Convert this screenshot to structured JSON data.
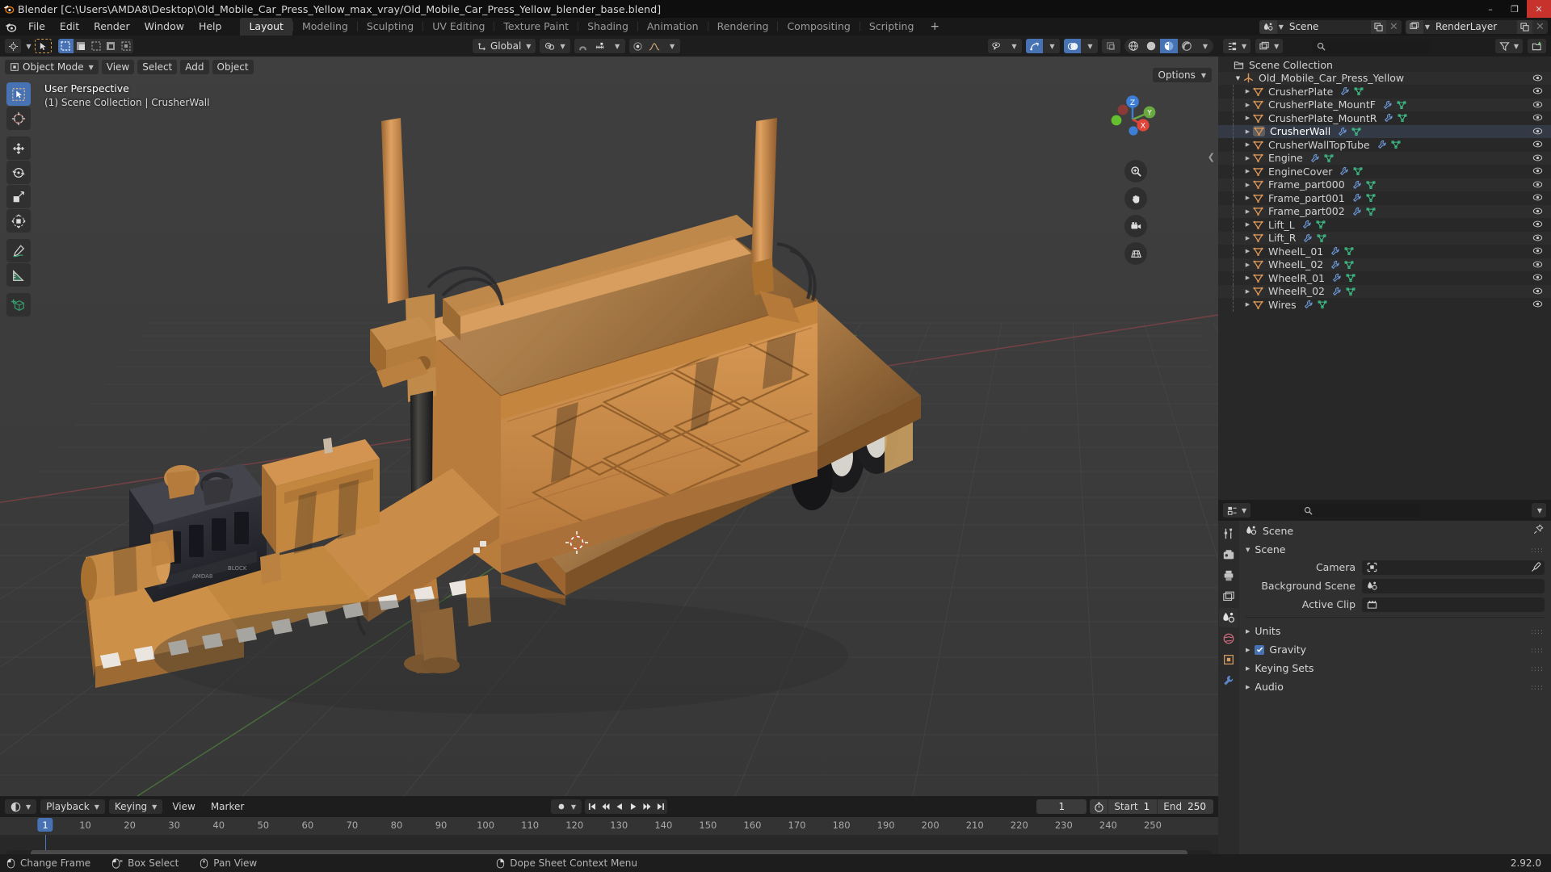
{
  "window": {
    "title": "Blender [C:\\Users\\AMDA8\\Desktop\\Old_Mobile_Car_Press_Yellow_max_vray/Old_Mobile_Car_Press_Yellow_blender_base.blend]",
    "minimize": "–",
    "maximize": "❐",
    "close": "✕"
  },
  "menus": [
    "File",
    "Edit",
    "Render",
    "Window",
    "Help"
  ],
  "workspace_tabs": [
    {
      "label": "Layout",
      "active": true
    },
    {
      "label": "Modeling",
      "active": false
    },
    {
      "label": "Sculpting",
      "active": false
    },
    {
      "label": "UV Editing",
      "active": false
    },
    {
      "label": "Texture Paint",
      "active": false
    },
    {
      "label": "Shading",
      "active": false
    },
    {
      "label": "Animation",
      "active": false
    },
    {
      "label": "Rendering",
      "active": false
    },
    {
      "label": "Compositing",
      "active": false
    },
    {
      "label": "Scripting",
      "active": false
    }
  ],
  "workspace_add": "+",
  "topbar_right": {
    "scene_name": "Scene",
    "viewlayer_name": "RenderLayer"
  },
  "viewport": {
    "mode": "Object Mode",
    "menus": [
      "View",
      "Select",
      "Add",
      "Object"
    ],
    "transform_orientation": "Global",
    "options_label": "Options",
    "overlay_line1": "User Perspective",
    "overlay_line2": "(1) Scene Collection | CrusherWall",
    "gizmo_axes": {
      "z": "Z",
      "y": "Y",
      "x": "X"
    },
    "tools": [
      "tweak-select-box-icon",
      "cursor-icon",
      "move-icon",
      "rotate-icon",
      "scale-icon",
      "transform-icon",
      "annotate-icon",
      "measure-icon",
      "add-cube-icon"
    ],
    "nav_buttons": [
      "zoom-icon",
      "pan-hand-icon",
      "camera-view-icon",
      "perspective-toggle-icon"
    ]
  },
  "outliner": {
    "search_placeholder": "",
    "display_mode": "View Layer",
    "items": [
      {
        "label": "Scene Collection",
        "indent": 0,
        "kind": "collection",
        "disclosure": "",
        "icons": [],
        "eye": false,
        "selected": false
      },
      {
        "label": "Old_Mobile_Car_Press_Yellow",
        "indent": 1,
        "kind": "empty",
        "disclosure": "open",
        "icons": [],
        "eye": true,
        "selected": false
      },
      {
        "label": "CrusherPlate",
        "indent": 2,
        "kind": "mesh",
        "disclosure": "closed",
        "icons": [
          "modifier-icon",
          "mesh-data-icon"
        ],
        "eye": true,
        "selected": false
      },
      {
        "label": "CrusherPlate_MountF",
        "indent": 2,
        "kind": "mesh",
        "disclosure": "closed",
        "icons": [
          "modifier-icon",
          "mesh-data-icon"
        ],
        "eye": true,
        "selected": false
      },
      {
        "label": "CrusherPlate_MountR",
        "indent": 2,
        "kind": "mesh",
        "disclosure": "closed",
        "icons": [
          "modifier-icon",
          "mesh-data-icon"
        ],
        "eye": true,
        "selected": false
      },
      {
        "label": "CrusherWall",
        "indent": 2,
        "kind": "mesh",
        "disclosure": "closed",
        "icons": [
          "modifier-icon",
          "mesh-data-icon"
        ],
        "eye": true,
        "selected": true
      },
      {
        "label": "CrusherWallTopTube",
        "indent": 2,
        "kind": "mesh",
        "disclosure": "closed",
        "icons": [
          "modifier-icon",
          "mesh-data-icon"
        ],
        "eye": true,
        "selected": false
      },
      {
        "label": "Engine",
        "indent": 2,
        "kind": "mesh",
        "disclosure": "closed",
        "icons": [
          "modifier-icon",
          "mesh-data-icon"
        ],
        "eye": true,
        "selected": false
      },
      {
        "label": "EngineCover",
        "indent": 2,
        "kind": "mesh",
        "disclosure": "closed",
        "icons": [
          "modifier-icon",
          "mesh-data-icon"
        ],
        "eye": true,
        "selected": false
      },
      {
        "label": "Frame_part000",
        "indent": 2,
        "kind": "mesh",
        "disclosure": "closed",
        "icons": [
          "modifier-icon",
          "mesh-data-icon"
        ],
        "eye": true,
        "selected": false
      },
      {
        "label": "Frame_part001",
        "indent": 2,
        "kind": "mesh",
        "disclosure": "closed",
        "icons": [
          "modifier-icon",
          "mesh-data-icon"
        ],
        "eye": true,
        "selected": false
      },
      {
        "label": "Frame_part002",
        "indent": 2,
        "kind": "mesh",
        "disclosure": "closed",
        "icons": [
          "modifier-icon",
          "mesh-data-icon"
        ],
        "eye": true,
        "selected": false
      },
      {
        "label": "Lift_L",
        "indent": 2,
        "kind": "mesh",
        "disclosure": "closed",
        "icons": [
          "modifier-icon",
          "mesh-data-icon"
        ],
        "eye": true,
        "selected": false
      },
      {
        "label": "Lift_R",
        "indent": 2,
        "kind": "mesh",
        "disclosure": "closed",
        "icons": [
          "modifier-icon",
          "mesh-data-icon"
        ],
        "eye": true,
        "selected": false
      },
      {
        "label": "WheelL_01",
        "indent": 2,
        "kind": "mesh",
        "disclosure": "closed",
        "icons": [
          "modifier-icon",
          "mesh-data-icon"
        ],
        "eye": true,
        "selected": false
      },
      {
        "label": "WheelL_02",
        "indent": 2,
        "kind": "mesh",
        "disclosure": "closed",
        "icons": [
          "modifier-icon",
          "mesh-data-icon"
        ],
        "eye": true,
        "selected": false
      },
      {
        "label": "WheelR_01",
        "indent": 2,
        "kind": "mesh",
        "disclosure": "closed",
        "icons": [
          "modifier-icon",
          "mesh-data-icon"
        ],
        "eye": true,
        "selected": false
      },
      {
        "label": "WheelR_02",
        "indent": 2,
        "kind": "mesh",
        "disclosure": "closed",
        "icons": [
          "modifier-icon",
          "mesh-data-icon"
        ],
        "eye": true,
        "selected": false
      },
      {
        "label": "Wires",
        "indent": 2,
        "kind": "mesh",
        "disclosure": "closed",
        "icons": [
          "modifier-icon",
          "mesh-data-icon"
        ],
        "eye": true,
        "selected": false
      }
    ]
  },
  "properties": {
    "search_placeholder": "",
    "breadcrumb": "Scene",
    "panels": [
      {
        "label": "Scene",
        "open": true
      },
      {
        "label": "Units",
        "open": false,
        "checkbox": false
      },
      {
        "label": "Gravity",
        "open": false,
        "checkbox": true
      },
      {
        "label": "Keying Sets",
        "open": false
      },
      {
        "label": "Audio",
        "open": false
      }
    ],
    "fields": [
      {
        "label": "Camera",
        "value": "",
        "icon": "camera-data-icon",
        "eyedropper": true
      },
      {
        "label": "Background Scene",
        "value": "",
        "icon": "scene-icon",
        "eyedropper": false
      },
      {
        "label": "Active Clip",
        "value": "",
        "icon": "movie-clip-icon",
        "eyedropper": false
      }
    ],
    "tabs": [
      "tool-icon",
      "render-icon",
      "output-icon",
      "view-layer-icon",
      "scene-icon",
      "world-icon",
      "object-icon",
      "modifier-icon"
    ]
  },
  "timeline": {
    "editor_menus": [
      "Playback",
      "Keying",
      "View",
      "Marker"
    ],
    "current_frame": "1",
    "start_label": "Start",
    "start_value": "1",
    "end_label": "End",
    "end_value": "250",
    "ticks": [
      10,
      20,
      30,
      40,
      50,
      60,
      70,
      80,
      90,
      100,
      110,
      120,
      130,
      140,
      150,
      160,
      170,
      180,
      190,
      200,
      210,
      220,
      230,
      240,
      250
    ],
    "playback_buttons": [
      "jump-to-start-icon",
      "prev-keyframe-icon",
      "play-reverse-icon",
      "play-icon",
      "next-keyframe-icon",
      "jump-to-end-icon"
    ]
  },
  "statusbar": {
    "items": [
      {
        "icon": "mouse-left-icon",
        "label": "Change Frame"
      },
      {
        "icon": "mouse-left-drag-icon",
        "label": "Box Select"
      },
      {
        "icon": "mouse-middle-icon",
        "label": "Pan View"
      },
      {
        "icon": "mouse-right-icon",
        "label": "Dope Sheet Context Menu"
      }
    ],
    "version": "2.92.0"
  },
  "colors": {
    "accent": "#4772b3",
    "close": "#c8322c",
    "mesh_orange": "#e08a3c",
    "mesh_green": "#3fc28a",
    "modifier_blue": "#6d97d6",
    "viewport_bg": "#3b3b3b",
    "model_yellow": "#d9913f"
  }
}
